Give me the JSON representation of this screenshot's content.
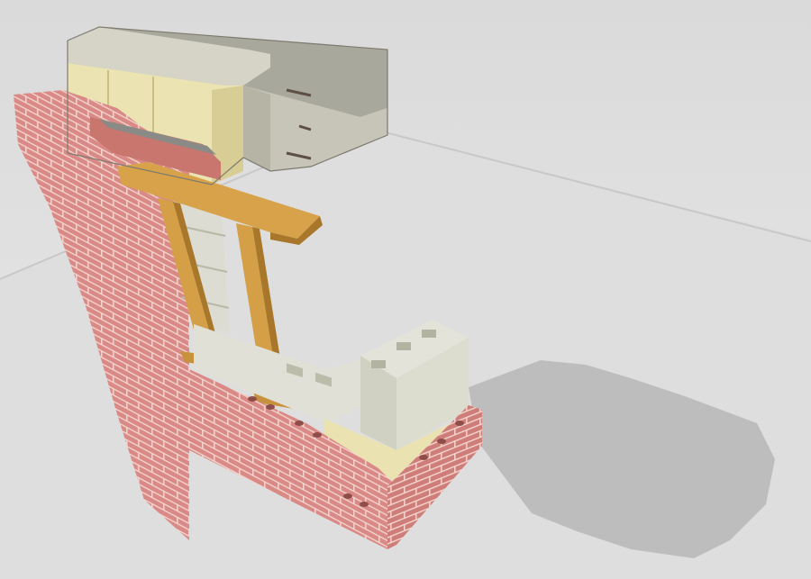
{
  "scene": {
    "description_free": true,
    "colors": {
      "background_wall": "#e3e3e3",
      "floor": "#d9d9d9",
      "shadow": "#b4b4b4",
      "brick": "#d98a86",
      "brick_dark": "#b76963",
      "mortar": "#f3d2cc",
      "cmu": "#dcdcd2",
      "cmu_dark": "#b7b7a6",
      "insulation": "#efe7b8",
      "insulation_dark": "#cfc48a",
      "concrete": "#a7a69a",
      "concrete_light": "#c9c7b9",
      "wood": "#d6a34a",
      "wood_dark": "#a8772a",
      "rebar": "#6e5d52"
    }
  }
}
